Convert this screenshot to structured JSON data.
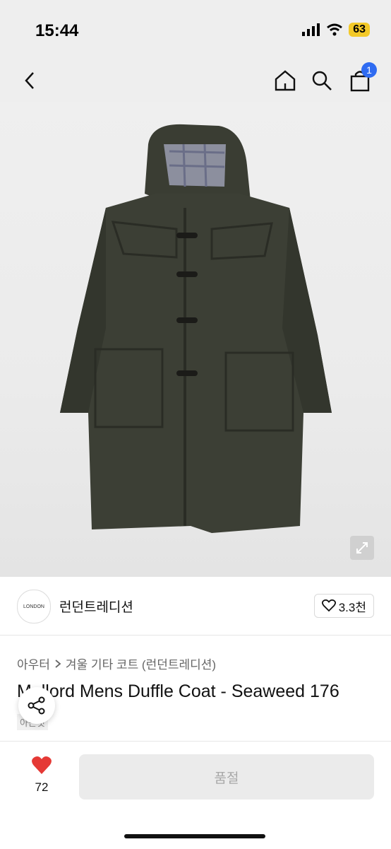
{
  "status": {
    "time": "15:44",
    "battery": "63"
  },
  "header": {
    "cart_count": "1"
  },
  "brand": {
    "logo_text": "LONDON",
    "name": "런던트레디션",
    "likes": "3.3천"
  },
  "breadcrumb": {
    "category": "아우터",
    "sub": "겨울 기타 코트 (런던트레디션)"
  },
  "product": {
    "title": "Mallord Mens Duffle Coat - Seaweed 176",
    "tag": "아는것"
  },
  "bottom": {
    "like_count": "72",
    "action_label": "품절"
  },
  "icons": [
    "back-icon",
    "home-icon",
    "search-icon",
    "cart-icon",
    "expand-icon",
    "heart-outline-icon",
    "share-icon",
    "heart-icon"
  ],
  "colors": {
    "badge": "#2f6bf1",
    "heart": "#e53935",
    "soldout_bg": "#ebebeb"
  }
}
